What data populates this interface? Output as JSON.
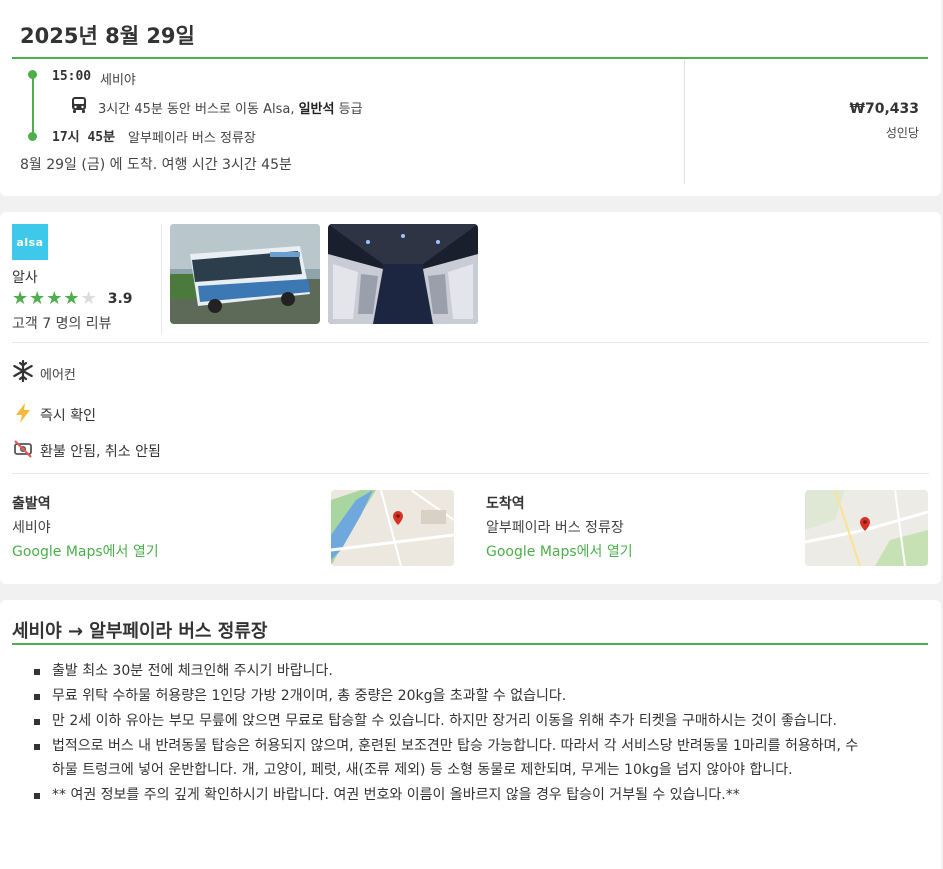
{
  "trip": {
    "date_title": "2025년 8월 29일",
    "depart_time": "15:00",
    "depart_place": "세비야",
    "travel_prefix": "3시간 45분 동안 버스로 이동 Alsa, ",
    "travel_class": "일반석",
    "travel_suffix": " 등급",
    "arrive_time": "17시 45분",
    "arrive_place": "알부페이라 버스 정류장",
    "arrival_summary": "8월 29일 (금) 에 도착. 여행 시간 3시간 45분",
    "price": "₩70,433",
    "price_unit": "성인당",
    "accent_color": "#4dae4b"
  },
  "operator": {
    "logo_text": "alsa",
    "name": "알사",
    "rating": "3.9",
    "stars_filled": 4,
    "stars_total": 5,
    "reviews": "고객 7 명의 리뷰",
    "photos": [
      "bus-exterior-photo",
      "bus-interior-photo"
    ]
  },
  "amenities": [
    {
      "icon": "snowflake-icon",
      "label": "에어컨"
    },
    {
      "icon": "lightning-icon",
      "label": "즉시 확인"
    },
    {
      "icon": "no-refund-icon",
      "label": "환불 안됨, 취소 안됨"
    }
  ],
  "stations": {
    "departure": {
      "heading": "출발역",
      "name": "세비야",
      "link": "Google Maps에서 열기"
    },
    "arrival": {
      "heading": "도착역",
      "name": "알부페이라 버스 정류장",
      "link": "Google Maps에서 열기"
    }
  },
  "info": {
    "route_title": "세비야 → 알부페이라 버스 정류장",
    "notes": [
      "출발 최소 30분 전에 체크인해 주시기 바랍니다.",
      "무료 위탁 수하물 허용량은 1인당 가방 2개이며, 총 중량은 20kg을 초과할 수 없습니다.",
      "만 2세 이하 유아는 부모 무릎에 앉으면 무료로 탑승할 수 있습니다. 하지만 장거리 이동을 위해 추가 티켓을 구매하시는 것이 좋습니다.",
      "법적으로 버스 내 반려동물 탑승은 허용되지 않으며, 훈련된 보조견만 탑승 가능합니다. 따라서 각 서비스당 반려동물 1마리를 허용하며, 수하물 트렁크에 넣어 운반합니다. 개, 고양이, 페럿, 새(조류 제외) 등 소형 동물로 제한되며, 무게는 10kg을 넘지 않아야 합니다.",
      "** 여권 정보를 주의 깊게 확인하시기 바랍니다. 여권 번호와 이름이 올바르지 않을 경우 탑승이 거부될 수 있습니다.**"
    ]
  }
}
